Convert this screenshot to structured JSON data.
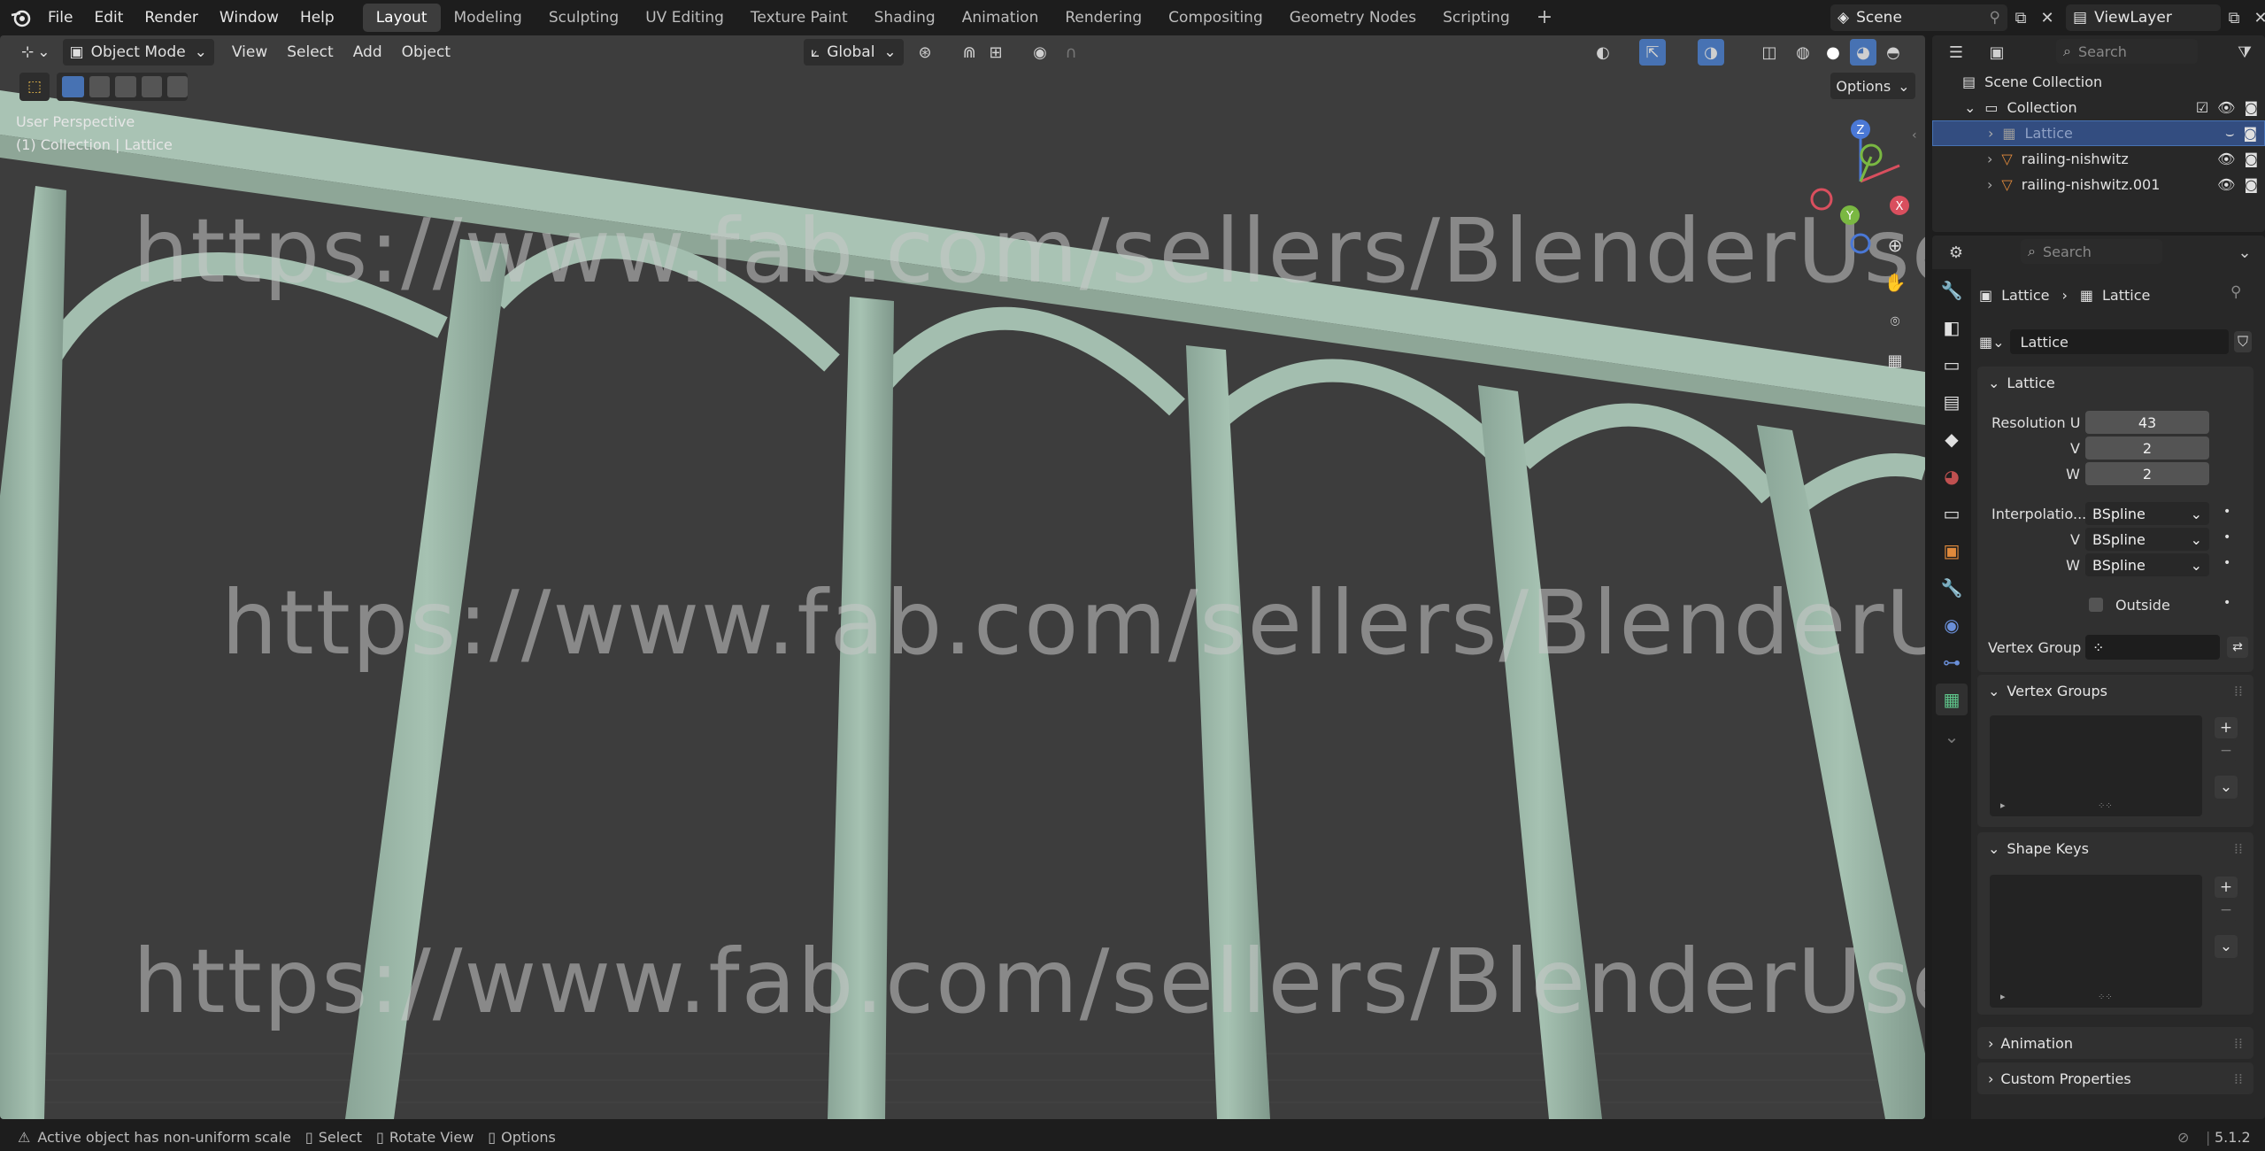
{
  "menu": {
    "file": "File",
    "edit": "Edit",
    "render": "Render",
    "window": "Window",
    "help": "Help"
  },
  "workspaces": [
    "Layout",
    "Modeling",
    "Sculpting",
    "UV Editing",
    "Texture Paint",
    "Shading",
    "Animation",
    "Rendering",
    "Compositing",
    "Geometry Nodes",
    "Scripting"
  ],
  "active_workspace": "Layout",
  "scene": {
    "name": "Scene",
    "view_layer": "ViewLayer"
  },
  "viewport_header": {
    "mode": "Object Mode",
    "view": "View",
    "select": "Select",
    "add": "Add",
    "object": "Object",
    "transform_orientation": "Global",
    "options": "Options"
  },
  "viewport_overlay": {
    "perspective": "User Perspective",
    "context": "(1) Collection | Lattice"
  },
  "gizmo": {
    "z": "Z",
    "y": "Y",
    "x": "X"
  },
  "outliner": {
    "search_placeholder": "Search",
    "scene_collection": "Scene Collection",
    "collection": "Collection",
    "items": [
      {
        "name": "Lattice",
        "type": "lattice",
        "selected": true
      },
      {
        "name": "railing-nishwitz",
        "type": "mesh",
        "selected": false
      },
      {
        "name": "railing-nishwitz.001",
        "type": "mesh",
        "selected": false
      }
    ]
  },
  "properties": {
    "search_placeholder": "Search",
    "breadcrumb": [
      "Lattice",
      "Lattice"
    ],
    "datablock_name": "Lattice",
    "lattice_panel": {
      "title": "Lattice",
      "resolution_u_label": "Resolution U",
      "resolution_u": "43",
      "v_label": "V",
      "resolution_v": "2",
      "w_label": "W",
      "resolution_w": "2",
      "interp_label": "Interpolatio...",
      "interp_u": "BSpline",
      "interp_v": "BSpline",
      "interp_w": "BSpline",
      "outside_label": "Outside",
      "vertex_group_label": "Vertex Group"
    },
    "vertex_groups_title": "Vertex Groups",
    "shape_keys_title": "Shape Keys",
    "animation_title": "Animation",
    "custom_properties_title": "Custom Properties"
  },
  "watermark": "https://www.fab.com/sellers/BlenderUserSkfb",
  "statusbar": {
    "message": "Active object has non-uniform scale",
    "select": "Select",
    "rotate": "Rotate View",
    "options": "Options",
    "version": "5.1.2"
  },
  "colors": {
    "accent": "#4772b3",
    "bg": "#1d1d1d",
    "viewport": "#3d3d3d",
    "model": "#9bb5a5"
  }
}
